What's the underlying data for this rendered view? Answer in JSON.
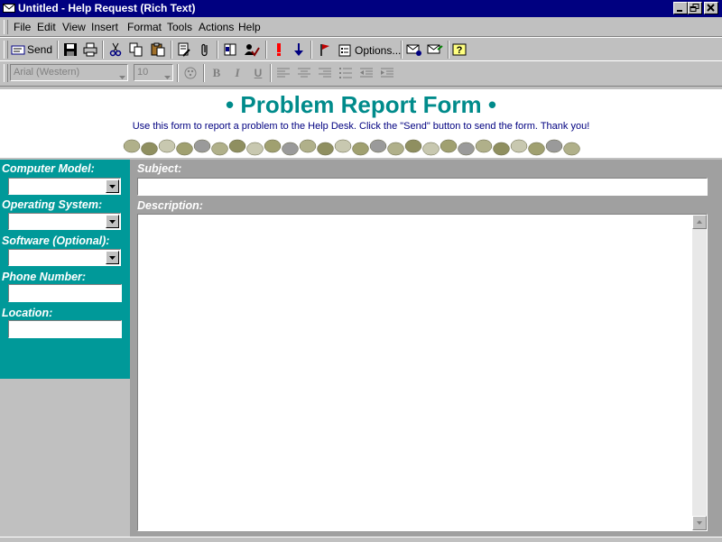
{
  "window": {
    "title": "Untitled - Help Request (Rich Text)"
  },
  "menu": [
    "File",
    "Edit",
    "View",
    "Insert",
    "Format",
    "Tools",
    "Actions",
    "Help"
  ],
  "toolbar": {
    "send_label": "Send",
    "options_label": "Options..."
  },
  "format_toolbar": {
    "font": "Arial (Western)",
    "size": "10",
    "bold": "B",
    "italic": "I",
    "underline": "U"
  },
  "form": {
    "title": "• Problem Report Form •",
    "instructions": "Use this form to report a problem to the Help Desk.  Click the \"Send\" button to send the form.  Thank you!",
    "labels": {
      "computer_model": "Computer Model:",
      "operating_system": "Operating System:",
      "software": "Software (Optional):",
      "phone": "Phone Number:",
      "location": "Location:",
      "subject": "Subject:",
      "description": "Description:"
    }
  },
  "colors": {
    "titlebar": "#000080",
    "teal": "#009999",
    "title_text": "#008b8b"
  }
}
